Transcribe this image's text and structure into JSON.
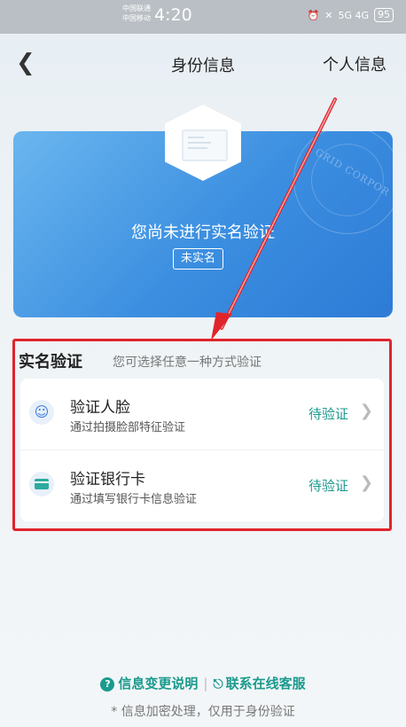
{
  "status_bar": {
    "carrier_line1": "中国联通",
    "carrier_line2": "中国移动",
    "time": "4:20",
    "signal": "5G 4G",
    "battery": "95"
  },
  "nav": {
    "back_icon": "back-icon",
    "title": "身份信息",
    "right_link": "个人信息"
  },
  "card": {
    "message": "您尚未进行实名验证",
    "badge": "未实名",
    "brand": "GRID CORPOR"
  },
  "verification": {
    "title": "实名验证",
    "subtitle": "您可选择任意一种方式验证",
    "methods": [
      {
        "title": "验证人脸",
        "desc": "通过拍摄脸部特征验证",
        "status": "待验证",
        "icon": "face-scan-icon"
      },
      {
        "title": "验证银行卡",
        "desc": "通过填写银行卡信息验证",
        "status": "待验证",
        "icon": "bank-card-icon"
      }
    ]
  },
  "footer": {
    "help_link": "信息变更说明",
    "service_link": "联系在线客服",
    "note": "* 信息加密处理，仅用于身份验证"
  },
  "colors": {
    "accent": "#1b9a8e",
    "card_blue": "#3b8ee0",
    "annotation_red": "#e0242b"
  }
}
